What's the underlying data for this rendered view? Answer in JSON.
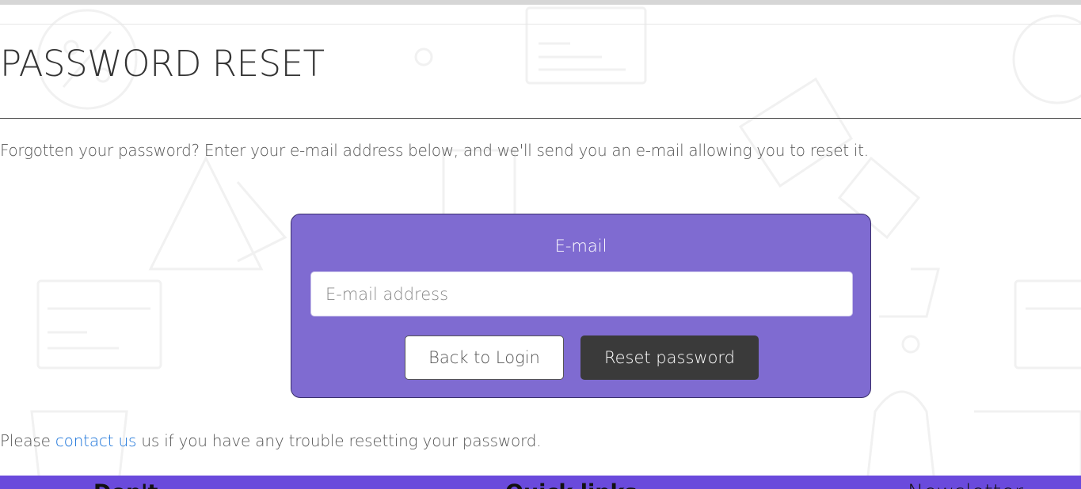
{
  "page": {
    "title": "PASSWORD RESET",
    "intro": "Forgotten your password? Enter your e-mail address below, and we'll send you an e-mail allowing you to reset it."
  },
  "form": {
    "email_label": "E-mail",
    "email_placeholder": "E-mail address",
    "email_value": "",
    "back_button_label": "Back to Login",
    "reset_button_label": "Reset password"
  },
  "help": {
    "prefix": "Please ",
    "link_text": "contact us",
    "suffix": " us if you have any trouble resetting your password."
  },
  "footer": {
    "headings": [
      "Don't",
      "Quick links",
      "Newsletter"
    ]
  },
  "colors": {
    "card_background": "#7f6bd1",
    "footer_background": "#6a4adc",
    "reset_button": "#3a3a3a",
    "link": "#1a73d9"
  }
}
